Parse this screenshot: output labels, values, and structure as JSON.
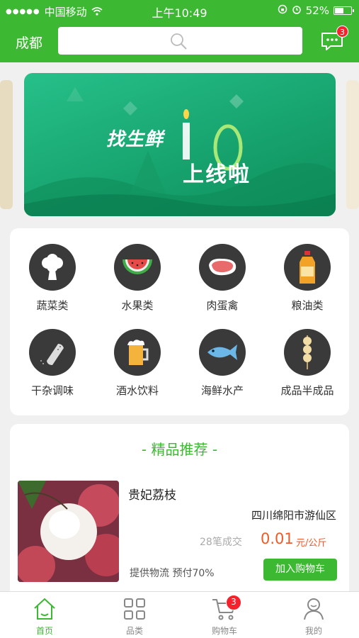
{
  "status_bar": {
    "carrier": "中国移动",
    "time": "上午10:49",
    "battery": "52%"
  },
  "header": {
    "city": "成都",
    "message_count": "3"
  },
  "banner": {
    "line1": "找生鲜",
    "version": "1.0",
    "line2": "上线啦"
  },
  "categories": [
    {
      "label": "蔬菜类",
      "icon": "broccoli-icon"
    },
    {
      "label": "水果类",
      "icon": "watermelon-icon"
    },
    {
      "label": "肉蛋禽",
      "icon": "meat-icon"
    },
    {
      "label": "粮油类",
      "icon": "oil-bottle-icon"
    },
    {
      "label": "干杂调味",
      "icon": "salt-shaker-icon"
    },
    {
      "label": "酒水饮料",
      "icon": "beer-icon"
    },
    {
      "label": "海鲜水产",
      "icon": "fish-icon"
    },
    {
      "label": "成品半成品",
      "icon": "skewer-icon"
    }
  ],
  "recommend": {
    "title": "- 精品推荐 -",
    "product": {
      "name": "贵妃荔枝",
      "location": "四川绵阳市游仙区",
      "sold": "28笔成交",
      "price": "0.01",
      "unit": "元/公斤",
      "tags": "提供物流  预付70%",
      "cart_button": "加入购物车"
    }
  },
  "tabbar": {
    "items": [
      {
        "label": "首页",
        "icon": "home-icon",
        "active": true
      },
      {
        "label": "品类",
        "icon": "category-grid-icon"
      },
      {
        "label": "购物车",
        "icon": "cart-icon",
        "badge": "3"
      },
      {
        "label": "我的",
        "icon": "user-icon"
      }
    ]
  },
  "colors": {
    "brand": "#3cb832",
    "price": "#f05a28",
    "badge": "#f5222d"
  }
}
